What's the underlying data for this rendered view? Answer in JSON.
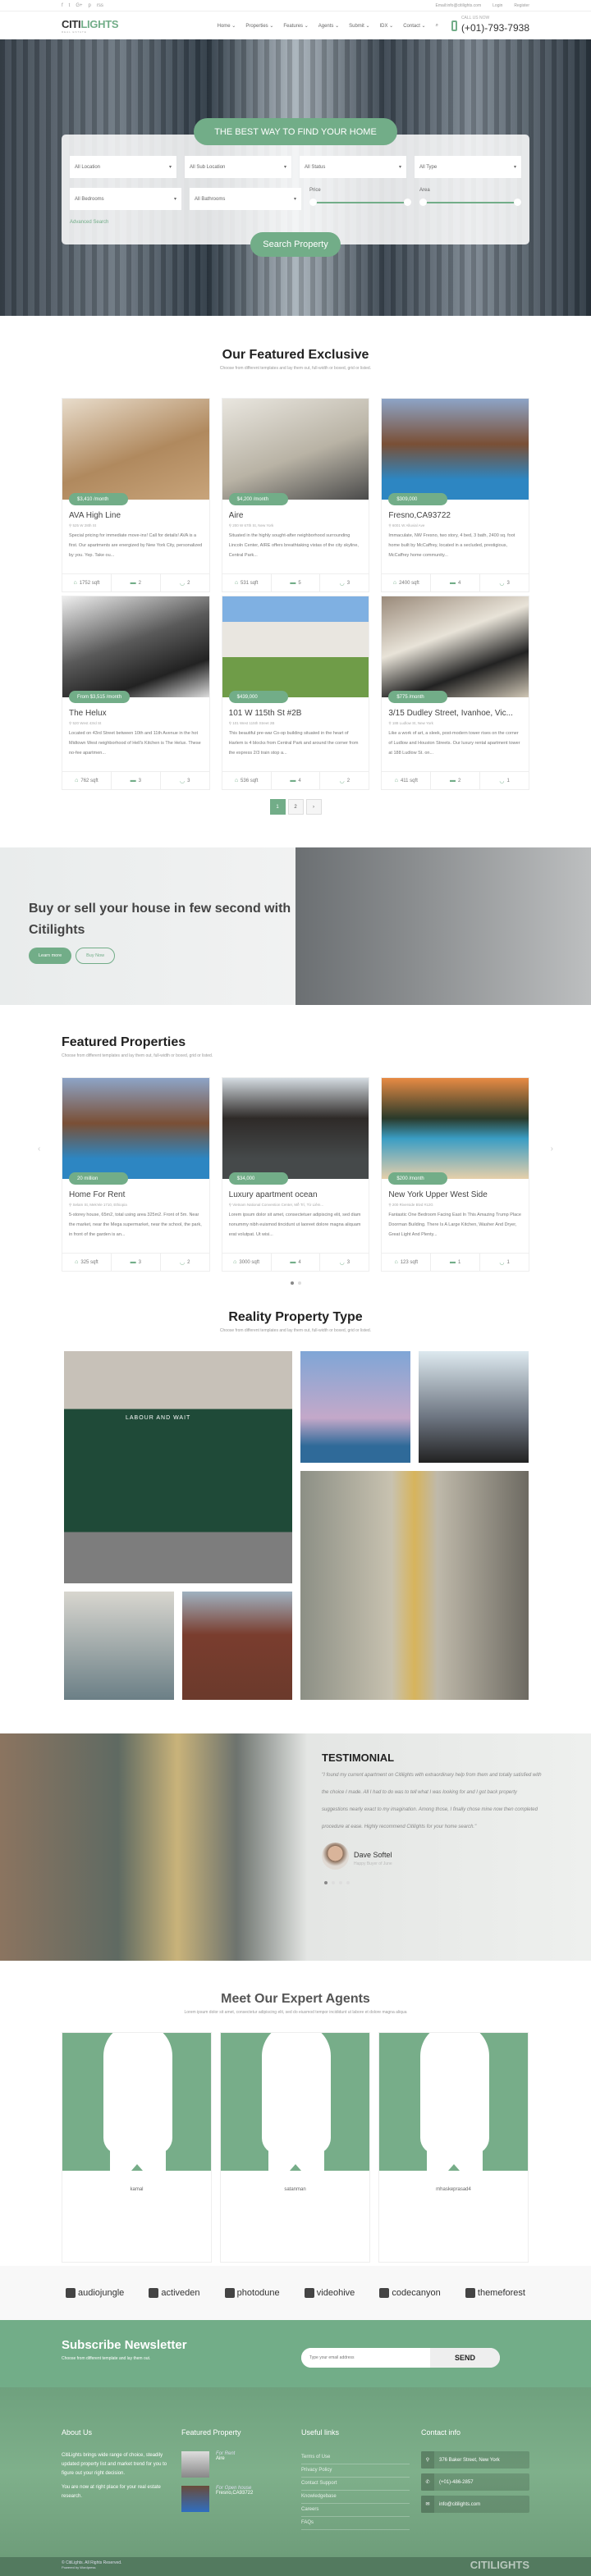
{
  "topbar": {
    "social": [
      "f",
      "t",
      "G+",
      "p",
      "rss"
    ],
    "email": "Email:info@citilights.com",
    "login": "Login",
    "register": "Register"
  },
  "header": {
    "logo_a": "CITI",
    "logo_b": "LIGHTS",
    "logo_tag": "REAL ESTATE",
    "nav": [
      "Home ⌄",
      "Properties ⌄",
      "Features ⌄",
      "Agents ⌄",
      "Submit ⌄",
      "IDX ⌄",
      "Contact ⌄"
    ],
    "call_label": "CALL US NOW",
    "phone": "(+01)-793-7938"
  },
  "search": {
    "title": "THE BEST WAY TO FIND YOUR HOME",
    "selects": [
      "All Location",
      "All Sub Location",
      "All Status",
      "All Type",
      "All Bedrooms",
      "All Bathrooms"
    ],
    "price": "Price",
    "area": "Area",
    "advanced": "Advanced Search",
    "button": "Search Property"
  },
  "exclusive": {
    "title": "Our Featured Exclusive",
    "subtitle": "Choose from different templates and lay them out, full-width or boxed, grid or listed.",
    "cards": [
      {
        "price": "$3,410 /month",
        "title": "AVA High Line",
        "address": "525 W 28th St",
        "desc": "Special pricing for immediate move-ins! Call for details! AVA is a first. Our apartments are energized by New York City, personalized by you. Yep. Take ou...",
        "area": "1752 sqft",
        "beds": "2",
        "baths": "2"
      },
      {
        "price": "$4,200 /month",
        "title": "Aire",
        "address": "200 W 67th St, New York",
        "desc": "Situated in the highly sought-after neighborhood surrounding Lincoln Center, AIRE offers breathtaking vistas of the city skyline, Central Park...",
        "area": "531 sqft",
        "beds": "5",
        "baths": "3"
      },
      {
        "price": "$309,000",
        "title": "Fresno,CA93722",
        "address": "6001 W Alluvial Ave",
        "desc": "Immaculate, NW Fresno, two story, 4 bed, 3 bath, 2400 sq. foot home built by McCaffrey, located in a secluded, prestigious, McCaffrey home community...",
        "area": "2400 sqft",
        "beds": "4",
        "baths": "3"
      },
      {
        "price": "From $3,515 /month",
        "title": "The Helux",
        "address": "520 West 43rd St",
        "desc": "Located on 43rd Street between 10th and 11th Avenue in the hot Midtown West neighborhood of Hell's Kitchen is The Helux. These no-fee apartmen...",
        "area": "762 sqft",
        "beds": "3",
        "baths": "3"
      },
      {
        "price": "$439,000",
        "title": "101 W 115th St #2B",
        "address": "101 West 115th Street 2B",
        "desc": "This beautiful pre-war Co-op building situated in the heart of Harlem is 4 blocks from Central Park and around the corner from the express 2/3 train stop a...",
        "area": "536 sqft",
        "beds": "4",
        "baths": "2"
      },
      {
        "price": "$775 /month",
        "title": "3/15 Dudley Street, Ivanhoe, Vic...",
        "address": "188 Ludlow St, New York",
        "desc": "Like a work of art, a sleek, post-modern tower rises on the corner of Ludlow and Houston Streets. Our luxury rental apartment tower at 188 Ludlow St. on...",
        "area": "411 sqft",
        "beds": "2",
        "baths": "1"
      }
    ],
    "pages": [
      "1",
      "2",
      "›"
    ]
  },
  "promo": {
    "title": "Buy or sell your house in few second with Citilights",
    "learn": "Learn more",
    "buy": "Buy Now"
  },
  "featured": {
    "title": "Featured Properties",
    "subtitle": "Choose from different templates and lay them out, full-width or boxed, grid or listed.",
    "cards": [
      {
        "price": "20 million",
        "title": "Home For Rent",
        "address": "Selam St, Mek'ele 1710, Ethiopia",
        "desc": "5-storey house, 65m2, total using area 325m2. Front of 5m. Near the market, near the Mega supermarket, near the school, the park, in front of the garden is an...",
        "area": "325 sqft",
        "beds": "3",
        "baths": "2"
      },
      {
        "price": "$34,000",
        "title": "Luxury apartment ocean",
        "address": "Vietnam National Convention Center, Mễ Trì, Từ Liêm...",
        "desc": "Lorem ipsum dolor sit amet, consectetuer adipiscing elit, sed diam nonummy nibh euismod tincidunt ut laoreet dolore magna aliquam erat volutpat. Ut wisi...",
        "area": "3000 sqft",
        "beds": "4",
        "baths": "3"
      },
      {
        "price": "$200 /month",
        "title": "New York Upper West Side",
        "address": "200 Riverside Blvd #12G",
        "desc": "Fantastic One Bedroom Facing East In This Amazing Trump Place Doorman Building. There Is A Large Kitchen, Washer And Dryer, Great Light And Plenty...",
        "area": "123 sqft",
        "beds": "1",
        "baths": "1"
      }
    ]
  },
  "types": {
    "title": "Reality Property Type",
    "subtitle": "Choose from different templates and lay them out, full-width or boxed, grid or listed.",
    "shop_sign": "LABOUR AND WAIT"
  },
  "testimonial": {
    "title": "TESTIMONIAL",
    "quote": "\"I found my current apartment on Citilights with extraordinary help from them and totally satisfied with the choice I made. All I had to do was to tell what I was looking for and I got back property suggestions nearly exact to my imagination. Among those, I finally chose mine now then completed procedure at ease. Highly recommend Citilights for your home search.\"",
    "name": "Dave Softel",
    "role": "Happy Buyer of June"
  },
  "agents": {
    "title": "Meet Our Expert Agents",
    "subtitle": "Lorem ipsum dolor sit amet, consectetur adipiscing elit, sed do eiusmod tempor incididunt ut labore et dolore magna aliqua",
    "names": [
      "kamal",
      "satanman",
      "mhaskeprasad4"
    ]
  },
  "brands": [
    "audiojungle",
    "activeden",
    "photodune",
    "videohive",
    "codecanyon",
    "themeforest"
  ],
  "newsletter": {
    "title": "Subscribe Newsletter",
    "subtitle": "Choose from different template and lay them out.",
    "placeholder": "Type your email address",
    "send": "SEND"
  },
  "footer": {
    "about_title": "About Us",
    "about_p1": "CitiLights brings wide range of choice, steadily updated property list and market trend for you to figure out your right decision.",
    "about_p2": "You are now at right place for your real estate research.",
    "fp_title": "Featured Property",
    "fp": [
      {
        "status": "For Rent",
        "name": "Aire"
      },
      {
        "status": "For Open house",
        "name": "Fresno,CA93722"
      }
    ],
    "links_title": "Useful links",
    "links": [
      "Terms of Use",
      "Privacy Policy",
      "Contact Support",
      "Knowledgebase",
      "Careers",
      "FAQs"
    ],
    "contact_title": "Contact info",
    "address": "376 Baker Street, New York",
    "phone": "(+01)-486-2857",
    "email": "info@citilights.com",
    "copyright": "© CitiLights. All Rights Reserved.",
    "powered": "Powered by Wordpress",
    "logo": "CITILIGHTS",
    "logo_tag": "REAL ESTATE"
  },
  "colors": {
    "accent": "#72ad88",
    "footer_bottom": "#537a5f"
  }
}
